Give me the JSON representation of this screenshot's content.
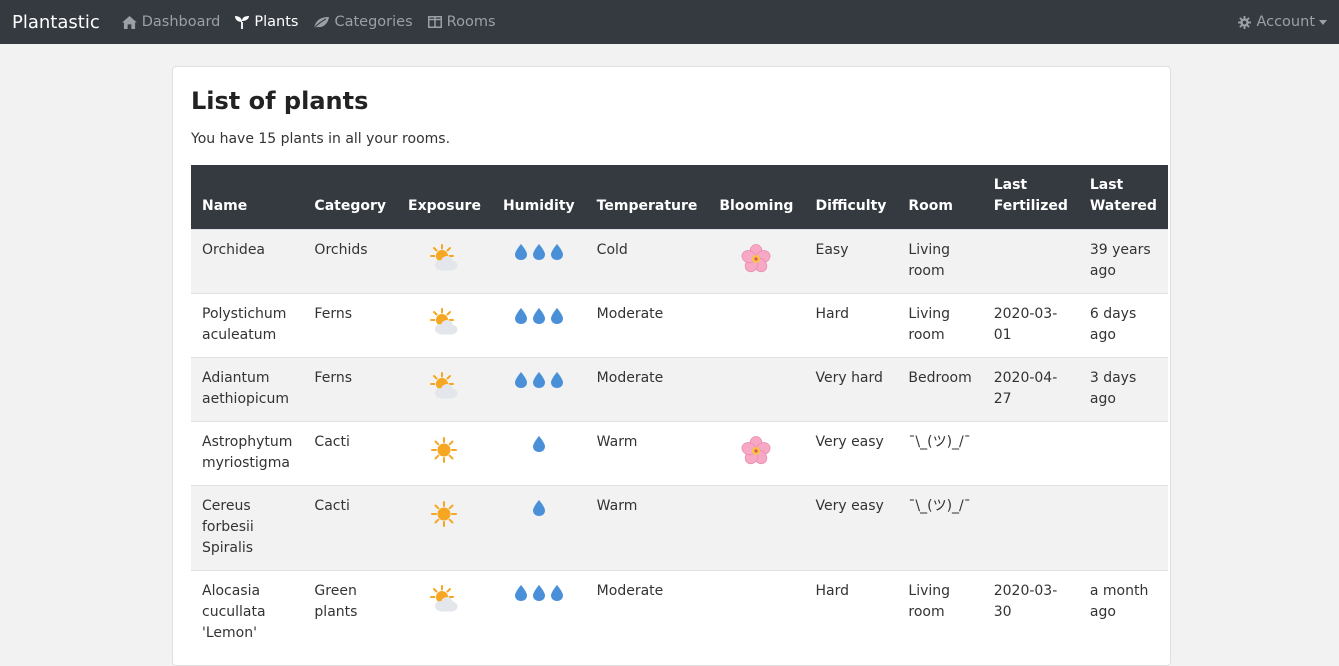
{
  "nav": {
    "brand": "Plantastic",
    "items": [
      {
        "label": "Dashboard",
        "icon": "home-icon"
      },
      {
        "label": "Plants",
        "icon": "seedling-icon",
        "active": true
      },
      {
        "label": "Categories",
        "icon": "leaf-icon"
      },
      {
        "label": "Rooms",
        "icon": "window-icon"
      }
    ],
    "account_label": "Account"
  },
  "page": {
    "title": "List of plants",
    "summary": "You have 15 plants in all your rooms."
  },
  "table": {
    "headers": [
      "Name",
      "Category",
      "Exposure",
      "Humidity",
      "Temperature",
      "Blooming",
      "Difficulty",
      "Room",
      "Last Fertilized",
      "Last Watered"
    ],
    "rows": [
      {
        "name": "Orchidea",
        "category": "Orchids",
        "exposure": "partly-sunny",
        "humidity": 3,
        "temperature": "Cold",
        "blooming": true,
        "difficulty": "Easy",
        "room": "Living room",
        "fertilized": "",
        "watered": "39 years ago"
      },
      {
        "name": "Polystichum aculeatum",
        "category": "Ferns",
        "exposure": "partly-sunny",
        "humidity": 3,
        "temperature": "Moderate",
        "blooming": false,
        "difficulty": "Hard",
        "room": "Living room",
        "fertilized": "2020-03-01",
        "watered": "6 days ago"
      },
      {
        "name": "Adiantum aethiopicum",
        "category": "Ferns",
        "exposure": "partly-sunny",
        "humidity": 3,
        "temperature": "Moderate",
        "blooming": false,
        "difficulty": "Very hard",
        "room": "Bedroom",
        "fertilized": "2020-04-27",
        "watered": "3 days ago"
      },
      {
        "name": "Astrophytum myriostigma",
        "category": "Cacti",
        "exposure": "sunny",
        "humidity": 1,
        "temperature": "Warm",
        "blooming": true,
        "difficulty": "Very easy",
        "room": "¯\\_(ツ)_/¯",
        "fertilized": "",
        "watered": ""
      },
      {
        "name": "Cereus forbesii Spiralis",
        "category": "Cacti",
        "exposure": "sunny",
        "humidity": 1,
        "temperature": "Warm",
        "blooming": false,
        "difficulty": "Very easy",
        "room": "¯\\_(ツ)_/¯",
        "fertilized": "",
        "watered": ""
      },
      {
        "name": "Alocasia cucullata 'Lemon'",
        "category": "Green plants",
        "exposure": "partly-sunny",
        "humidity": 3,
        "temperature": "Moderate",
        "blooming": false,
        "difficulty": "Hard",
        "room": "Living room",
        "fertilized": "2020-03-30",
        "watered": "a month ago"
      }
    ]
  },
  "colors": {
    "navbar": "#343a40",
    "sun": "#f6a623",
    "cloud": "#e3e6ea",
    "drop": "#4a90d9",
    "blossom": "#f7a8c4"
  }
}
